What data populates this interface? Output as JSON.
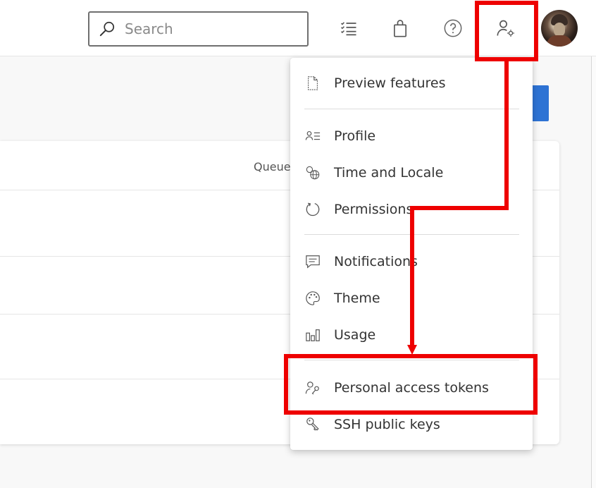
{
  "header": {
    "search_placeholder": "Search",
    "icons": [
      "search-icon",
      "task-list-icon",
      "shopping-bag-icon",
      "help-icon",
      "user-settings-icon"
    ]
  },
  "background_table": {
    "column_header_partial": "Queue"
  },
  "user_settings_menu": {
    "groups": [
      [
        {
          "label": "Preview features",
          "icon": "document-icon"
        }
      ],
      [
        {
          "label": "Profile",
          "icon": "profile-card-icon"
        },
        {
          "label": "Time and Locale",
          "icon": "globe-locale-icon"
        },
        {
          "label": "Permissions",
          "icon": "refresh-circle-icon"
        }
      ],
      [
        {
          "label": "Notifications",
          "icon": "chat-message-icon"
        },
        {
          "label": "Theme",
          "icon": "palette-icon"
        },
        {
          "label": "Usage",
          "icon": "bar-chart-icon"
        }
      ],
      [
        {
          "label": "Personal access tokens",
          "icon": "user-key-icon"
        },
        {
          "label": "SSH public keys",
          "icon": "ssh-key-icon"
        }
      ]
    ]
  },
  "annotations": {
    "color": "#ee0000",
    "highlighted": [
      "user-settings-icon",
      "Personal access tokens"
    ]
  },
  "colors": {
    "accent": "#2e73d4",
    "annotation_red": "#ee0000"
  }
}
